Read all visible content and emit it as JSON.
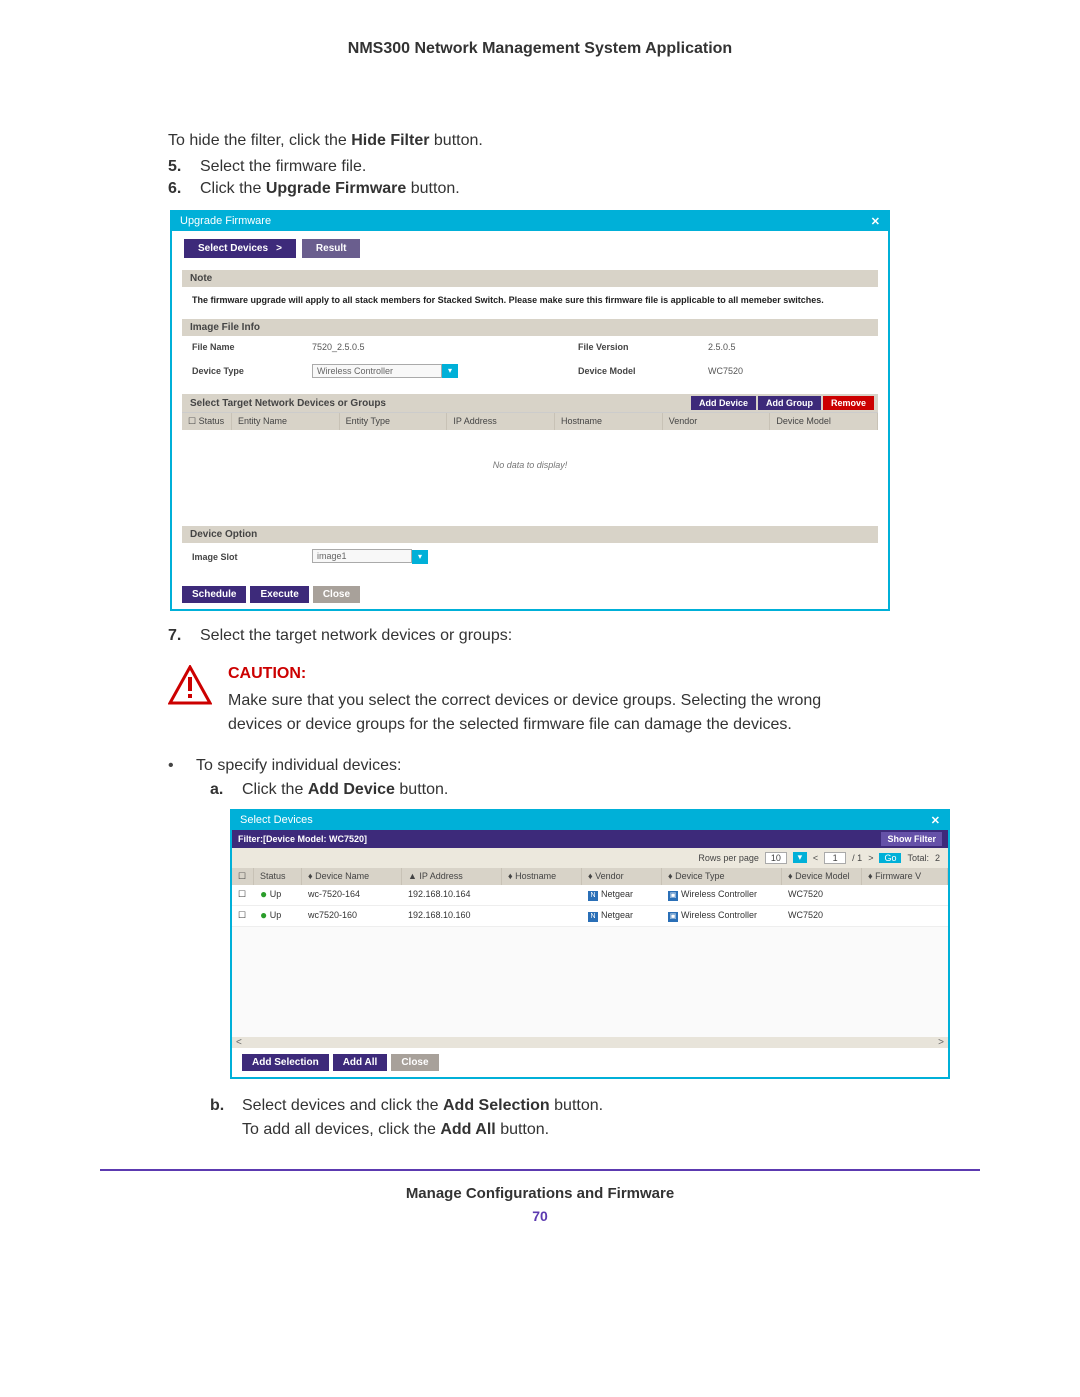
{
  "doc": {
    "header": "NMS300 Network Management System Application",
    "para_intro": "To hide the filter, click the",
    "para_intro_bold": "Hide Filter",
    "para_intro_end": "button.",
    "step5": "Select the firmware file.",
    "step6_pre": "Click the",
    "step6_bold": "Upgrade Firmware",
    "step6_post": "button.",
    "step7": "Select the target network devices or groups:",
    "caution_label": "CAUTION:",
    "caution_body": "Make sure that you select the correct devices or device groups. Selecting the wrong devices or device groups for the selected firmware file can damage the devices.",
    "bullet1": "To specify individual devices:",
    "sub_a_pre": "Click the",
    "sub_a_bold": "Add Device",
    "sub_a_post": "button.",
    "sub_b_pre": "Select devices and click the",
    "sub_b_bold": "Add Selection",
    "sub_b_post": "button.",
    "sub_b_line2_pre": "To add all devices, click the",
    "sub_b_line2_bold": "Add All",
    "sub_b_line2_post": "button.",
    "footer_section": "Manage Configurations and Firmware",
    "footer_page": "70"
  },
  "ss1": {
    "title": "Upgrade Firmware",
    "tab1": "Select Devices",
    "tab2": "Result",
    "note_section": "Note",
    "note_text": "The firmware upgrade will apply to all stack members for Stacked Switch. Please make sure this firmware file is applicable to all memeber switches.",
    "imgfile_section": "Image File Info",
    "file_name_lbl": "File Name",
    "file_name_val": "7520_2.5.0.5",
    "file_ver_lbl": "File Version",
    "file_ver_val": "2.5.0.5",
    "dev_type_lbl": "Device Type",
    "dev_type_val": "Wireless Controller",
    "dev_model_lbl": "Device Model",
    "dev_model_val": "WC7520",
    "target_section": "Select Target Network Devices or Groups",
    "btn_add_device": "Add Device",
    "btn_add_group": "Add Group",
    "btn_remove": "Remove",
    "cols": {
      "status": "Status",
      "entity_name": "Entity Name",
      "entity_type": "Entity Type",
      "ip": "IP Address",
      "hostname": "Hostname",
      "vendor": "Vendor",
      "model": "Device Model"
    },
    "no_data": "No data to display!",
    "dev_option_section": "Device Option",
    "image_slot_lbl": "Image Slot",
    "image_slot_val": "image1",
    "btn_schedule": "Schedule",
    "btn_execute": "Execute",
    "btn_close": "Close"
  },
  "ss2": {
    "title": "Select Devices",
    "filter_label": "Filter:[Device Model: WC7520]",
    "show_filter": "Show Filter",
    "pager_rows_lbl": "Rows per page",
    "pager_rows_val": "10",
    "pager_page": "1",
    "pager_total_pages": "/ 1",
    "pager_go": "Go",
    "pager_total_lbl": "Total:",
    "pager_total_val": "2",
    "cols": {
      "status": "Status",
      "name": "Device Name",
      "ip": "IP Address",
      "host": "Hostname",
      "vendor": "Vendor",
      "type": "Device Type",
      "model": "Device Model",
      "fw": "Firmware V"
    },
    "rows": [
      {
        "status": "Up",
        "name": "wc-7520-164",
        "ip": "192.168.10.164",
        "host": "",
        "vendor": "Netgear",
        "type": "Wireless Controller",
        "model": "WC7520"
      },
      {
        "status": "Up",
        "name": "wc7520-160",
        "ip": "192.168.10.160",
        "host": "",
        "vendor": "Netgear",
        "type": "Wireless Controller",
        "model": "WC7520"
      }
    ],
    "btn_add_selection": "Add Selection",
    "btn_add_all": "Add All",
    "btn_close": "Close"
  }
}
